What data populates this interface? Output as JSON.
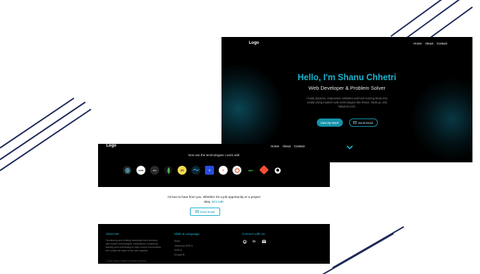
{
  "colors": {
    "accent": "#1bb3cf",
    "deco": "#1f2a5a",
    "background": "#000000"
  },
  "hero_window": {
    "logo": "Logo",
    "nav": [
      "Home",
      "About",
      "Contact"
    ],
    "title": "Hello, I'm Shanu Chhetri",
    "subtitle": "Web Developer & Problem Solver",
    "description": "I build dynamic, responsive websites and love turning ideas into reality using modern web technologies like React, Node.js, and Tailwind CSS.",
    "btn_work": "View My Work",
    "btn_email": "Send Email",
    "scroll_icon": "chevron-down-icon"
  },
  "front_window": {
    "logo": "Logo",
    "nav": [
      "Home",
      "About",
      "Contact"
    ],
    "tech_title": "here are the technologies I work with",
    "tech_icons": [
      "react-icon",
      "nodejs-icon",
      "express-icon",
      "mongodb-icon",
      "javascript-icon",
      "tailwind-icon",
      "css3-icon",
      "html5-icon",
      "redux-icon",
      "npm-icon",
      "git-icon",
      "github-icon"
    ],
    "contact_text": "I'd love to hear from you. Whether it's a job opportunity or a project idea,",
    "contact_link": "let's talk!",
    "contact_btn": "Send Email",
    "footer": {
      "about_head": "About Me",
      "about_text": "Freelancing and building meaningful web solutions with modern technologies. Dedicated to continuous learning and contributing to open source communities. let's create the future of the web together.",
      "skills_head": "Skills & Language",
      "skills": [
        "React",
        "JavaScript (ES6+)",
        "Node.js",
        "MongoDB"
      ],
      "connect_head": "Connect with Us",
      "social_icons": [
        "github-icon",
        "linkedin-icon",
        "mail-icon"
      ],
      "copyright": "© 2024 Shanu Chhetri. All rights reserved."
    }
  }
}
